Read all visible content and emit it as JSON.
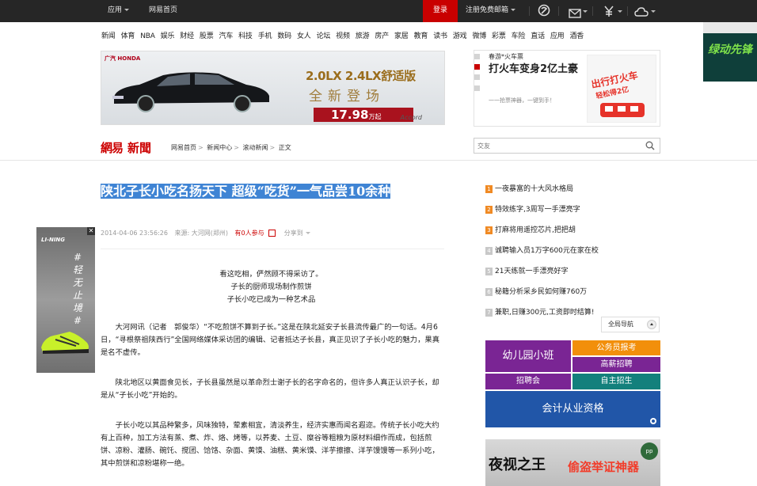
{
  "topbar": {
    "apps": "应用",
    "home": "网易首页",
    "login": "登录",
    "register": "注册免费邮箱"
  },
  "channels": [
    "新闻",
    "体育",
    "NBA",
    "娱乐",
    "财经",
    "股票",
    "汽车",
    "科技",
    "手机",
    "数码",
    "女人",
    "论坛",
    "视频",
    "旅游",
    "房产",
    "家居",
    "教育",
    "读书",
    "游戏",
    "微博",
    "彩票",
    "车险",
    "直话",
    "应用",
    "酒香"
  ],
  "side_ad": {
    "text": "绿动先锋"
  },
  "car_ad": {
    "brand": "广汽 HONDA",
    "title": "2.0LX 2.4LX舒适版",
    "slogan": "全新登场",
    "price": "17.98",
    "price_unit": "万起",
    "model": "Accord"
  },
  "train_promo": {
    "small": "春游*火车票",
    "title": "打火车变身2亿土豪",
    "sub": "一一抢票神器，一键到手！",
    "img_text1": "出行打火车",
    "img_text2": "轻松得2亿"
  },
  "logo": {
    "part1": "網易",
    "part2": "新聞"
  },
  "breadcrumb": [
    "网易首页",
    "新闻中心",
    "滚动新闻",
    "正文"
  ],
  "search": {
    "placeholder": "交友"
  },
  "article": {
    "title": "陕北子长小吃名扬天下 超级“吃货”一气品尝10余种",
    "datetime": "2014-04-06 23:56:26",
    "source": "来源: 大河网(郑州)",
    "participants": "有0人参与",
    "share": "分享到",
    "captions": [
      "看这吃相，俨然顾不得采访了。",
      "子长的厨师现场制作煎饼",
      "子长小吃已成为一种艺术品"
    ],
    "paragraphs": [
      "大河网讯（记者　郭俊华）“不吃煎饼不算到子长。”这是在陕北延安子长县流传最广的一句话。4月6日，“寻根祭祖陕西行”全国网络媒体采访团的编辑、记者抵达子长县，真正见识了子长小吃的魅力，果真是名不虚传。",
      "陕北地区以黄面食见长，子长县虽然是以革命烈士谢子长的名字命名的，但许多人真正认识子长，却是从“子长小吃”开始的。",
      "子长小吃以其品种繁多，风味独特，荤素相宜，清淡养生，经济实惠而闻名遐迩。传统子长小吃大约有上百种，加工方法有蒸、煮、炸、烙、烤等，以荞麦、土豆、糜谷等粗粮为原材料细作而成，包括煎饼、凉粉、灌肠、碗饦、搅团、饸饹、杂面、黄馍、油糕、黄米馍、洋芋擦擦、洋芋馒馒等一系列小吃，其中煎饼和凉粉堪称一绝。"
    ]
  },
  "shoe_ad": {
    "brand": "LI-NING",
    "slogan": "#轻无止境#",
    "close": "✕"
  },
  "rank": [
    {
      "num": "1",
      "text": "一夜暴富的十大风水格局"
    },
    {
      "num": "2",
      "text": "特效练字,3周写一手漂亮字"
    },
    {
      "num": "3",
      "text": "打麻将用遥控芯片,把把胡"
    },
    {
      "num": "4",
      "text": "诚聘输入员1万字600元在家在校"
    },
    {
      "num": "5",
      "text": "21天练就一手漂亮好字"
    },
    {
      "num": "6",
      "text": "秘籍分析采乡民如何赚760万"
    },
    {
      "num": "7",
      "text": "兼职,日赚300元,工资即时结算!"
    }
  ],
  "fullnav": "全局导航",
  "ad_grid": [
    "幼儿园小班",
    "公务员报考",
    "高薪招聘",
    "招聘会",
    "自主招生",
    "会计从业资格"
  ],
  "nv_ad": {
    "t1": "夜视之王",
    "t2": "偷盗举证神器",
    "badge": "pp"
  },
  "colors": {
    "brand_red": "#c90000",
    "highlight": "#3f84d4",
    "hot": "#f08a24",
    "purple": "#7a2594",
    "orange": "#f28f0b",
    "teal": "#13807c",
    "blue": "#2156a8"
  }
}
